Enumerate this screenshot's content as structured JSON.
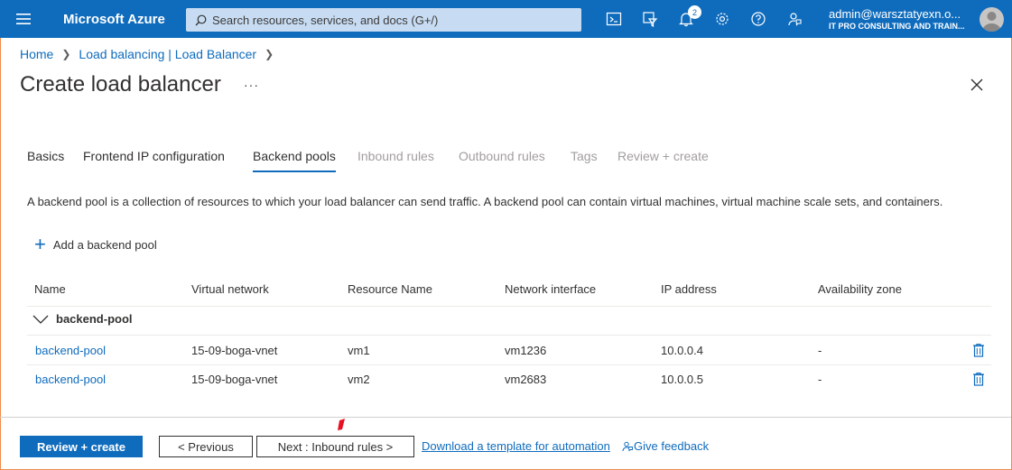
{
  "topbar": {
    "brand": "Microsoft Azure",
    "search_placeholder": "Search resources, services, and docs (G+/)",
    "icons": [
      "cloud-shell-icon",
      "directory-filter-icon",
      "notifications-icon",
      "settings-icon",
      "help-icon",
      "feedback-icon"
    ],
    "notification_count": "2",
    "account_email": "admin@warsztatyexn.o...",
    "account_org": "IT PRO CONSULTING AND TRAIN..."
  },
  "breadcrumb": {
    "home": "Home",
    "parent": "Load balancing | Load Balancer"
  },
  "page": {
    "title": "Create load balancer",
    "more": "···"
  },
  "tabs": [
    {
      "label": "Basics",
      "state": "enabled"
    },
    {
      "label": "Frontend IP configuration",
      "state": "enabled"
    },
    {
      "label": "Backend pools",
      "state": "active"
    },
    {
      "label": "Inbound rules",
      "state": "disabled"
    },
    {
      "label": "Outbound rules",
      "state": "disabled"
    },
    {
      "label": "Tags",
      "state": "disabled"
    },
    {
      "label": "Review + create",
      "state": "disabled"
    }
  ],
  "description": "A backend pool is a collection of resources to which your load balancer can send traffic. A backend pool can contain virtual machines, virtual machine scale sets, and containers.",
  "add_pool_label": "Add a backend pool",
  "table": {
    "columns": [
      "Name",
      "Virtual network",
      "Resource Name",
      "Network interface",
      "IP address",
      "Availability zone"
    ],
    "group": "backend-pool",
    "rows": [
      {
        "name": "backend-pool",
        "vnet": "15-09-boga-vnet",
        "resource": "vm1",
        "nic": "vm1236",
        "ip": "10.0.0.4",
        "zone": "-"
      },
      {
        "name": "backend-pool",
        "vnet": "15-09-boga-vnet",
        "resource": "vm2",
        "nic": "vm2683",
        "ip": "10.0.0.5",
        "zone": "-"
      }
    ]
  },
  "footer": {
    "review_create": "Review + create",
    "previous": "< Previous",
    "next": "Next : Inbound rules >",
    "download_template": "Download a template for automation",
    "give_feedback": "Give feedback"
  },
  "colors": {
    "accent": "#0f6cbd",
    "frame_border": "#f08a4b",
    "disabled_text": "#a19f9d"
  }
}
